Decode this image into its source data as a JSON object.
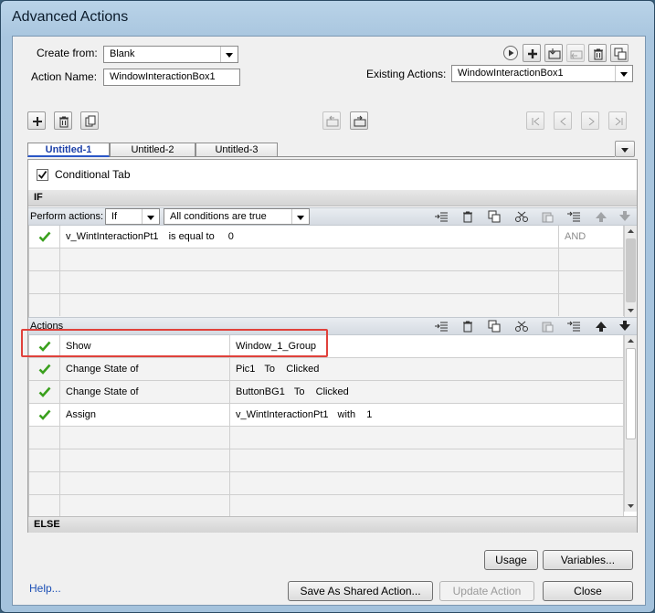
{
  "window": {
    "title": "Advanced Actions"
  },
  "form": {
    "create_from_label": "Create from:",
    "create_from_value": "Blank",
    "action_name_label": "Action Name:",
    "action_name_value": "WindowInteractionBox1",
    "existing_actions_label": "Existing Actions:",
    "existing_actions_value": "WindowInteractionBox1"
  },
  "tabs": [
    {
      "label": "Untitled-1",
      "active": true
    },
    {
      "label": "Untitled-2"
    },
    {
      "label": "Untitled-3"
    }
  ],
  "conditional_tab": {
    "label": "Conditional Tab",
    "checked": true
  },
  "if_section": {
    "header": "IF",
    "perform_actions_label": "Perform actions:",
    "perform_select": "If",
    "condition_select": "All conditions are true",
    "rows": [
      {
        "variable": "v_WintInteractionPt1",
        "operator": "is equal to",
        "value": "0",
        "logic": "AND"
      }
    ]
  },
  "actions_section": {
    "header": "Actions",
    "rows": [
      {
        "action": "Show",
        "target": "Window_1_Group",
        "target_rest": ""
      },
      {
        "action": "Change State of",
        "target": "Pic1",
        "target_rest": "To    Clicked"
      },
      {
        "action": "Change State of",
        "target": "ButtonBG1",
        "target_rest": "To    Clicked"
      },
      {
        "action": "Assign",
        "target": "v_WintInteractionPt1",
        "target_rest": "with    1"
      }
    ]
  },
  "else_section": {
    "header": "ELSE"
  },
  "buttons": {
    "usage": "Usage",
    "variables": "Variables...",
    "help": "Help...",
    "save_shared": "Save As Shared Action...",
    "update": "Update Action",
    "close": "Close"
  },
  "colors": {
    "accent": "#1b3fa8",
    "check": "#3aa01d",
    "highlight": "#e0413b"
  }
}
